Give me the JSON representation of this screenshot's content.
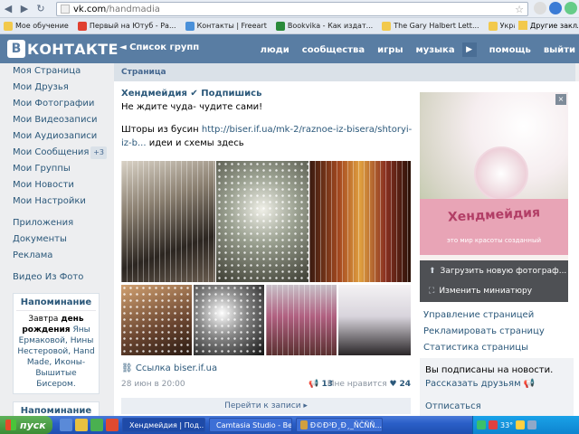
{
  "browser": {
    "url_domain": "vk.com",
    "url_path": "/handmadia",
    "bookmarks": [
      {
        "label": "Мое обучение",
        "color": "#f2c94c"
      },
      {
        "label": "Первый на Ютуб - Ра...",
        "color": "#e04030"
      },
      {
        "label": "Контакты | Freeart",
        "color": "#4a90d9"
      },
      {
        "label": "Bookvika - Как издат...",
        "color": "#2a8a3a"
      },
      {
        "label": "The Gary Halbert Lett...",
        "color": "#f2c94c"
      },
      {
        "label": "Украшения Анкарс, ...",
        "color": "#f2c94c"
      }
    ],
    "other_bookmarks": "Другие закл"
  },
  "header": {
    "logo_letter": "В",
    "logo_text": "КОНТАКТЕ",
    "groups_link": "◄ Список групп",
    "menu": [
      "люди",
      "сообщества",
      "игры",
      "музыка"
    ],
    "menu_more": "▶",
    "help": "помощь",
    "logout": "выйти"
  },
  "sidebar": {
    "items": [
      {
        "label": "Моя Страница"
      },
      {
        "label": "Мои Друзья"
      },
      {
        "label": "Мои Фотографии"
      },
      {
        "label": "Мои Видеозаписи"
      },
      {
        "label": "Мои Аудиозаписи"
      },
      {
        "label": "Мои Сообщения",
        "count": "+3"
      },
      {
        "label": "Мои Группы"
      },
      {
        "label": "Мои Новости"
      },
      {
        "label": "Мои Настройки"
      }
    ],
    "apps": [
      {
        "label": "Приложения"
      },
      {
        "label": "Документы"
      },
      {
        "label": "Реклама"
      }
    ],
    "extra": "Видео Из Фото",
    "reminder1": {
      "title": "Напоминание",
      "text_pre": "Завтра ",
      "text_bold": "день рождения",
      "text_post": " Яны Ермаковой, Нины Нестеровой, Hand Made, Иконы-Вышитые Бисером."
    },
    "reminder2_title": "Напоминание"
  },
  "breadcrumb": "Страница",
  "post": {
    "author": "Хендмейдия ✔ Подпишись",
    "subtitle": "Не ждите чуда- чудите сами!",
    "text_pre": "Шторы из бусин ",
    "text_link": "http://biser.if.ua/mk-2/raznoe-iz-bisera/shtoryi-iz-b...",
    "text_post": " идеи и схемы здесь",
    "link": "Ссылка biser.if.ua",
    "date": "28 июн в 20:00",
    "shares": "13",
    "likes_label": "Мне нравится",
    "likes_count": "24",
    "goto": "Перейти к записи ▸"
  },
  "cover": {
    "title": "Хендмейдия",
    "subtitle": "это мир красоты созданный",
    "close": "×",
    "upload": "Загрузить новую фотограф...",
    "thumb": "Изменить миниатюру"
  },
  "right_links": [
    "Управление страницей",
    "Рекламировать страницу",
    "Статистика страницы"
  ],
  "subscription": {
    "status": "Вы подписаны на новости.",
    "tell": "Рассказать друзьям",
    "unsubscribe": "Отписаться"
  },
  "taskbar": {
    "start": "пуск",
    "tasks": [
      {
        "label": "Хендмейдия | Под...",
        "color": "#e8a040"
      },
      {
        "label": "Camtasia Studio - Bes...",
        "color": "#3aa04a"
      },
      {
        "label": "Ð©Ð²Ð¸Ð¸_ÑČÑÑ...",
        "color": "#d0a040"
      }
    ],
    "tray_text": "33°"
  }
}
